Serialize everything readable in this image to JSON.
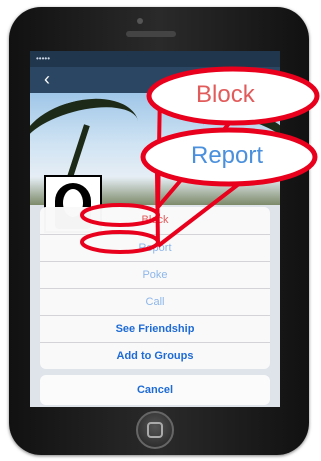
{
  "status_bar": {
    "carrier": "••••• ",
    "time": ""
  },
  "nav": {
    "back_glyph": "‹"
  },
  "action_sheet": {
    "items": [
      {
        "label": "Block",
        "style": "destructive"
      },
      {
        "label": "Report",
        "style": "faded"
      },
      {
        "label": "Poke",
        "style": "faded"
      },
      {
        "label": "Call",
        "style": "faded"
      },
      {
        "label": "See Friendship",
        "style": "bold"
      },
      {
        "label": "Add to Groups",
        "style": "bold"
      }
    ],
    "cancel_label": "Cancel"
  },
  "callouts": {
    "block_label": "Block",
    "report_label": "Report"
  },
  "colors": {
    "highlight_red": "#e8001c",
    "destructive": "#e25b5b",
    "ios_blue": "#2f7de1"
  }
}
